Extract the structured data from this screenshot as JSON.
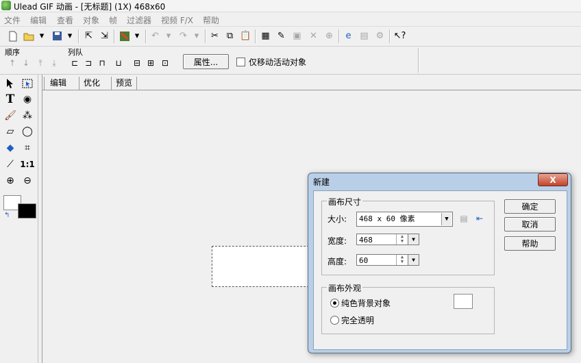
{
  "window": {
    "title": "Ulead GIF 动画 - [无标题] (1X) 468x60"
  },
  "menu": [
    "文件",
    "编辑",
    "查看",
    "对象",
    "帧",
    "过滤器",
    "视频 F/X",
    "帮助"
  ],
  "toolbar": {
    "icons": [
      "new-file-icon",
      "open-folder-icon",
      "dropdown-icon",
      "save-icon",
      "dropdown-icon",
      "import-icon",
      "export-icon",
      "color-palette-icon",
      "dropdown-icon",
      "undo-icon",
      "dropdown-icon",
      "redo-icon",
      "dropdown-icon",
      "cut-icon",
      "copy-icon",
      "paste-icon",
      "frame-panel-icon",
      "image-editor-icon",
      "optimize-icon",
      "delete-icon",
      "duplicate-icon",
      "browser-preview-icon",
      "disabled-preview-icon",
      "disabled-wizard-icon",
      "context-help-icon"
    ]
  },
  "arrange_bar": {
    "order_label": "顺序",
    "align_label": "列队",
    "properties_button": "属性...",
    "move_active_checkbox": "仅移动活动对象"
  },
  "tools": [
    "pick-tool-icon",
    "marquee-tool-icon",
    "text-tool-icon",
    "lasso-tool-icon",
    "brush-tool-icon",
    "magic-wand-tool-icon",
    "eraser-tool-icon",
    "ellipse-select-icon",
    "fill-tool-icon",
    "crop-tool-icon",
    "eyedropper-tool-icon",
    "actual-size-icon",
    "zoom-in-icon",
    "zoom-out-icon"
  ],
  "tool_labels": {
    "actual_size": "1:1"
  },
  "colors": {
    "foreground": "#000000",
    "background": "#ffffff"
  },
  "tabs": [
    "编辑",
    "优化",
    "预览"
  ],
  "dialog": {
    "title": "新建",
    "close_symbol": "X",
    "canvas_size_group": "画布尺寸",
    "size_label": "大小:",
    "size_value": "468 x 60 像素",
    "width_label": "宽度:",
    "width_value": "468",
    "height_label": "高度:",
    "height_value": "60",
    "appearance_group": "画布外观",
    "solid_bg_option": "纯色背景对象",
    "transparent_option": "完全透明",
    "ok_button": "确定",
    "cancel_button": "取消",
    "help_button": "帮助"
  }
}
